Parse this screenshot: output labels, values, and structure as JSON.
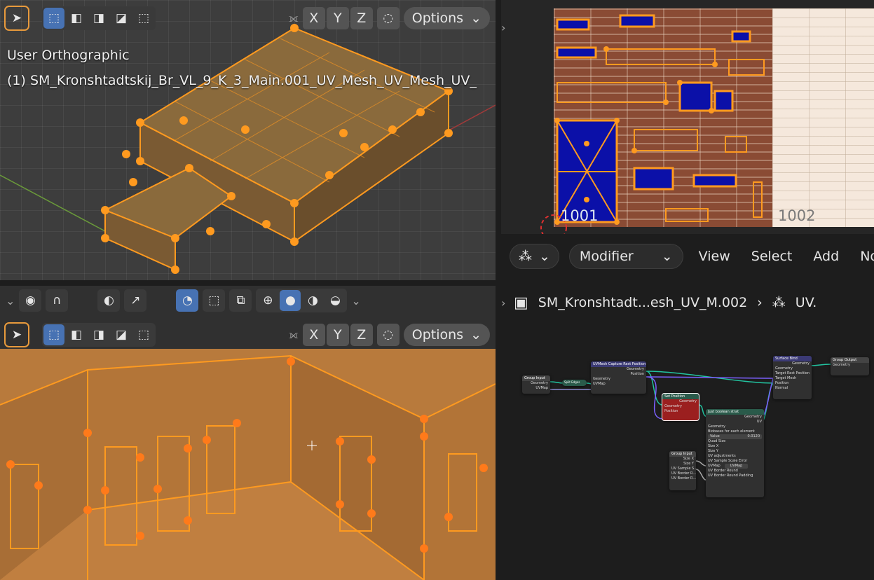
{
  "top_viewport": {
    "view_label": "User Orthographic",
    "object_label": "(1) SM_Kronshtadtskij_Br_VL_9_K_3_Main.001_UV_Mesh_UV_Mesh_UV_",
    "axes": [
      "X",
      "Y",
      "Z"
    ],
    "options_label": "Options"
  },
  "bottom_viewport": {
    "axes": [
      "X",
      "Y",
      "Z"
    ],
    "options_label": "Options"
  },
  "uv_editor": {
    "tile_1001": "1001",
    "tile_1002": "1002"
  },
  "node_editor": {
    "editor_type": "Modifier",
    "menu": [
      "View",
      "Select",
      "Add",
      "Nod"
    ],
    "breadcrumb_object": "SM_Kronshtadt...esh_UV_M.002",
    "breadcrumb_tree": "UV.",
    "nodes": {
      "group_input_top": {
        "title": "Group Input",
        "rows": [
          "Geometry",
          "UVMap"
        ]
      },
      "split_edges": {
        "title": "Split Edges"
      },
      "uv_capture": {
        "title": "UVMesh Capture Rest Position",
        "rows": [
          "Geometry",
          "Position",
          "Geometry",
          "UVMap"
        ]
      },
      "set_position": {
        "title": "Set Position",
        "rows": [
          "Geometry",
          "Geometry",
          "Position"
        ]
      },
      "uv_unwrap": {
        "title": "Just boolean strat",
        "rows": [
          "Geometry",
          "UV",
          "Geometry",
          "Biobases for each element",
          "Value",
          "0.0120",
          "Quad Size",
          "Size X",
          "Size Y",
          "UV adjustments",
          "UV Sample Scale Error",
          "UVMap",
          "UVMap",
          "UV Border Round",
          "UV Border Round Padding"
        ]
      },
      "group_input_bottom": {
        "title": "Group Input",
        "rows": [
          "Size X",
          "Size Y",
          "UV Sample S...",
          "UV Border R...",
          "UV Border R..."
        ]
      },
      "surface_bind": {
        "title": "Surface Bind",
        "rows": [
          "Geometry",
          "Geometry",
          "Target Rest Position",
          "Target Mesh",
          "Position",
          "Normal"
        ]
      },
      "group_output": {
        "title": "Group Output",
        "rows": [
          "Geometry"
        ]
      }
    }
  }
}
